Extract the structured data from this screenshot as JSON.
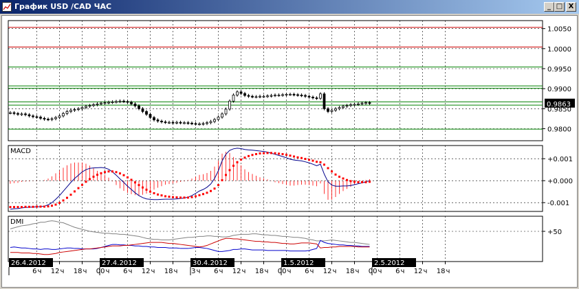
{
  "window": {
    "title": "График USD /CAD  ЧАС",
    "buttons": {
      "minimize": "_",
      "maximize": "□",
      "close": "X"
    }
  },
  "chart_data": [
    {
      "type": "candlestick",
      "name": "price",
      "ylim": [
        0.977,
        1.007
      ],
      "y_ticks": [
        "1.0050",
        "1.0000",
        "0.9950",
        "0.9900",
        "0.9850",
        "0.9800"
      ],
      "y_tick_values": [
        1.005,
        1.0,
        0.995,
        0.99,
        0.985,
        0.98
      ],
      "last_price": "0.9863",
      "last_price_value": 0.9863,
      "levels": [
        {
          "value": 1.0053,
          "color": "#cc0000"
        },
        {
          "value": 1.0004,
          "color": "#cc0000"
        },
        {
          "value": 0.9954,
          "color": "#008000"
        },
        {
          "value": 0.9907,
          "color": "#008000"
        },
        {
          "value": 0.9901,
          "color": "#008000"
        },
        {
          "value": 0.9867,
          "color": "#008000"
        },
        {
          "value": 0.9859,
          "color": "#008000"
        },
        {
          "value": 0.9799,
          "color": "#008000"
        }
      ],
      "x": [
        0,
        1,
        2,
        3,
        4,
        5,
        6,
        7,
        8,
        9,
        10,
        11,
        12,
        13,
        14,
        15,
        16,
        17,
        18,
        19,
        20,
        21,
        22,
        23,
        24,
        25,
        26,
        27,
        28,
        29,
        30,
        31,
        32,
        33,
        34,
        35,
        36,
        37,
        38,
        39,
        40,
        41,
        42,
        43,
        44,
        45,
        46,
        47,
        48,
        49,
        50,
        51,
        52,
        53,
        54,
        55,
        56,
        57,
        58,
        59,
        60,
        61,
        62,
        63,
        64,
        65,
        66,
        67,
        68,
        69,
        70,
        71,
        72,
        73,
        74,
        75,
        76,
        77,
        78,
        79,
        80,
        81,
        82,
        83,
        84,
        85,
        86,
        87,
        88,
        89,
        90,
        91,
        92,
        93,
        94,
        95
      ],
      "close": [
        0.984,
        0.9838,
        0.9836,
        0.9837,
        0.9835,
        0.9832,
        0.983,
        0.9829,
        0.9826,
        0.9824,
        0.9823,
        0.9825,
        0.9828,
        0.9832,
        0.9838,
        0.9843,
        0.9846,
        0.9848,
        0.985,
        0.9853,
        0.9856,
        0.9858,
        0.986,
        0.9862,
        0.9864,
        0.9865,
        0.9866,
        0.9867,
        0.9868,
        0.9869,
        0.9868,
        0.9866,
        0.9862,
        0.9857,
        0.985,
        0.9843,
        0.9836,
        0.9828,
        0.9822,
        0.9819,
        0.9817,
        0.9816,
        0.9816,
        0.9815,
        0.9816,
        0.9815,
        0.9815,
        0.9814,
        0.9813,
        0.9812,
        0.9812,
        0.9813,
        0.9815,
        0.9818,
        0.9823,
        0.9829,
        0.9837,
        0.9849,
        0.9869,
        0.9884,
        0.9892,
        0.9888,
        0.9883,
        0.9881,
        0.988,
        0.988,
        0.9881,
        0.9881,
        0.9882,
        0.9883,
        0.9884,
        0.9884,
        0.9885,
        0.9886,
        0.9886,
        0.9885,
        0.9884,
        0.9883,
        0.9881,
        0.9879,
        0.9877,
        0.9876,
        0.9887,
        0.985,
        0.9843,
        0.9846,
        0.985,
        0.9853,
        0.9856,
        0.9858,
        0.986,
        0.9861,
        0.9862,
        0.9864,
        0.9865,
        0.9863
      ]
    },
    {
      "type": "macd",
      "name": "MACD",
      "ylim": [
        -0.0014,
        0.0016
      ],
      "y_ticks": [
        "+0.001",
        "+0.000",
        "-0.001"
      ],
      "y_tick_values": [
        0.001,
        0.0,
        -0.001
      ],
      "series": [
        {
          "name": "",
          "role": "main",
          "color": "#00008b",
          "values": [
            -0.0013,
            -0.00128,
            -0.00127,
            -0.00124,
            -0.00122,
            -0.00121,
            -0.0012,
            -0.00119,
            -0.00118,
            -0.00116,
            -0.0011,
            -0.001,
            -0.00085,
            -0.00068,
            -0.00048,
            -0.00028,
            -8e-05,
            0.0001,
            0.00025,
            0.0004,
            0.0005,
            0.00056,
            0.00058,
            0.00059,
            0.0006,
            0.00058,
            0.00052,
            0.0004,
            0.00025,
            8e-05,
            -8e-05,
            -0.00025,
            -0.0004,
            -0.00055,
            -0.00068,
            -0.00077,
            -0.00083,
            -0.00085,
            -0.00086,
            -0.00086,
            -0.00085,
            -0.00084,
            -0.00084,
            -0.00084,
            -0.00083,
            -0.00081,
            -0.00079,
            -0.00075,
            -0.00068,
            -0.00058,
            -0.00047,
            -0.0004,
            -0.0003,
            -0.00015,
            0.0001,
            0.00045,
            0.0009,
            0.0012,
            0.00138,
            0.00145,
            0.00148,
            0.00146,
            0.00142,
            0.0014,
            0.00139,
            0.00137,
            0.00135,
            0.00133,
            0.0013,
            0.00125,
            0.0012,
            0.00115,
            0.0011,
            0.00104,
            0.00098,
            0.00094,
            0.00092,
            0.0009,
            0.00086,
            0.00081,
            0.00075,
            0.00068,
            0.00075,
            0.0003,
            -5e-05,
            -0.0002,
            -0.00025,
            -0.00025,
            -0.00024,
            -0.00024,
            -0.00022,
            -0.00018,
            -0.00014,
            -0.0001,
            -5e-05,
            0.0
          ]
        },
        {
          "name": "",
          "role": "signal",
          "color": "#ff0000",
          "values": [
            -0.0012,
            -0.0012,
            -0.0012,
            -0.0012,
            -0.00119,
            -0.00119,
            -0.00119,
            -0.00118,
            -0.00118,
            -0.00118,
            -0.00117,
            -0.00114,
            -0.00109,
            -0.00101,
            -0.0009,
            -0.00078,
            -0.00064,
            -0.00049,
            -0.00034,
            -0.00019,
            -5e-05,
            7e-05,
            0.00018,
            0.00027,
            0.00034,
            0.00039,
            0.00042,
            0.00042,
            0.00039,
            0.00033,
            0.00025,
            0.00015,
            4e-05,
            -8e-05,
            -0.0002,
            -0.00031,
            -0.00041,
            -0.0005,
            -0.00057,
            -0.00063,
            -0.00067,
            -0.00071,
            -0.00073,
            -0.00075,
            -0.00076,
            -0.00077,
            -0.00077,
            -0.00077,
            -0.00075,
            -0.00071,
            -0.00066,
            -0.00061,
            -0.00055,
            -0.00047,
            -0.00036,
            -0.0002,
            2e-05,
            0.00026,
            0.00048,
            0.00068,
            0.00084,
            0.00096,
            0.00105,
            0.00112,
            0.00117,
            0.00121,
            0.00124,
            0.00125,
            0.00126,
            0.00126,
            0.00125,
            0.00123,
            0.00121,
            0.00118,
            0.00114,
            0.0011,
            0.00106,
            0.00103,
            0.00099,
            0.00095,
            0.00091,
            0.00086,
            0.00084,
            0.00073,
            0.00057,
            0.00042,
            0.00028,
            0.00018,
            0.0001,
            3e-05,
            -2e-05,
            -5e-05,
            -7e-05,
            -7e-05,
            -7e-05,
            -5e-05
          ]
        }
      ]
    },
    {
      "type": "line",
      "name": "DMI",
      "ylim": [
        -10,
        80
      ],
      "y_ticks": [
        "+50"
      ],
      "y_tick_values": [
        50
      ],
      "series": [
        {
          "name": "",
          "role": "adx",
          "color": "#808080",
          "values": [
            55,
            57,
            59,
            61,
            62,
            63,
            65,
            66,
            68,
            68,
            70,
            71,
            70,
            68,
            67,
            64,
            61,
            58,
            56,
            54,
            52,
            50,
            49,
            48,
            47,
            46,
            46,
            45,
            45,
            44,
            44,
            43,
            42,
            41,
            40,
            38,
            36,
            35,
            34,
            34,
            33,
            33,
            33,
            34,
            35,
            36,
            37,
            38,
            38,
            39,
            40,
            40,
            41,
            41,
            40,
            40,
            39,
            39,
            40,
            42,
            43,
            44,
            44,
            44,
            45,
            45,
            44,
            43,
            43,
            42,
            42,
            41,
            40,
            40,
            39,
            38,
            38,
            37,
            36,
            34,
            33,
            31,
            31,
            31,
            32,
            33,
            32,
            31,
            30,
            29,
            28,
            28,
            27,
            26,
            25,
            24
          ]
        },
        {
          "name": "",
          "role": "plus_di",
          "color": "#0000cc",
          "values": [
            18,
            19,
            18,
            17,
            17,
            16,
            15,
            15,
            14,
            15,
            15,
            14,
            14,
            15,
            16,
            17,
            17,
            16,
            16,
            15,
            15,
            15,
            15,
            16,
            18,
            20,
            22,
            24,
            24,
            23,
            23,
            22,
            22,
            21,
            21,
            20,
            20,
            19,
            19,
            18,
            18,
            18,
            17,
            17,
            17,
            16,
            16,
            16,
            17,
            18,
            18,
            17,
            16,
            14,
            12,
            10,
            10,
            11,
            12,
            14,
            14,
            15,
            15,
            14,
            13,
            13,
            13,
            13,
            12,
            12,
            12,
            12,
            12,
            12,
            11,
            11,
            11,
            11,
            11,
            12,
            14,
            16,
            32,
            28,
            26,
            25,
            24,
            23,
            23,
            22,
            22,
            21,
            21,
            20,
            20,
            20
          ]
        },
        {
          "name": "",
          "role": "minus_di",
          "color": "#cc0000",
          "values": [
            8,
            8,
            8,
            7,
            7,
            7,
            6,
            6,
            5,
            4,
            4,
            5,
            6,
            8,
            9,
            10,
            11,
            12,
            13,
            14,
            15,
            15,
            16,
            17,
            18,
            19,
            20,
            21,
            21,
            21,
            22,
            22,
            23,
            24,
            25,
            26,
            27,
            28,
            28,
            28,
            28,
            27,
            26,
            26,
            25,
            24,
            23,
            22,
            21,
            20,
            19,
            20,
            22,
            25,
            28,
            31,
            34,
            36,
            36,
            35,
            35,
            34,
            33,
            32,
            31,
            30,
            30,
            29,
            29,
            28,
            28,
            27,
            26,
            26,
            25,
            25,
            26,
            27,
            27,
            27,
            26,
            25,
            17,
            18,
            18,
            19,
            19,
            20,
            20,
            20,
            20,
            20,
            19,
            19,
            19,
            19
          ]
        }
      ]
    }
  ],
  "x_axis": {
    "hour_ticks": [
      {
        "i": 7,
        "label": "6"
      },
      {
        "i": 13,
        "label": "12"
      },
      {
        "i": 19,
        "label": "18"
      },
      {
        "i": 25,
        "label": "00"
      },
      {
        "i": 31,
        "label": "6"
      },
      {
        "i": 37,
        "label": "12"
      },
      {
        "i": 43,
        "label": "18"
      },
      {
        "i": 49,
        "label": "3"
      },
      {
        "i": 55,
        "label": "6"
      },
      {
        "i": 61,
        "label": "12"
      },
      {
        "i": 67,
        "label": "18"
      },
      {
        "i": 73,
        "label": "00"
      },
      {
        "i": 79,
        "label": "6"
      },
      {
        "i": 85,
        "label": "12"
      },
      {
        "i": 91,
        "label": "18"
      },
      {
        "i": 97,
        "label": "00"
      },
      {
        "i": 103,
        "label": "6"
      },
      {
        "i": 109,
        "label": "12"
      },
      {
        "i": 115,
        "label": "18"
      }
    ],
    "date_tags": [
      {
        "i": 0,
        "label": "26.4.2012"
      },
      {
        "i": 24,
        "label": "27.4.2012"
      },
      {
        "i": 48,
        "label": "30.4.2012"
      },
      {
        "i": 72,
        "label": "1.5.2012"
      },
      {
        "i": 96,
        "label": "2.5.2012"
      }
    ],
    "hour_suffix": "ч"
  }
}
